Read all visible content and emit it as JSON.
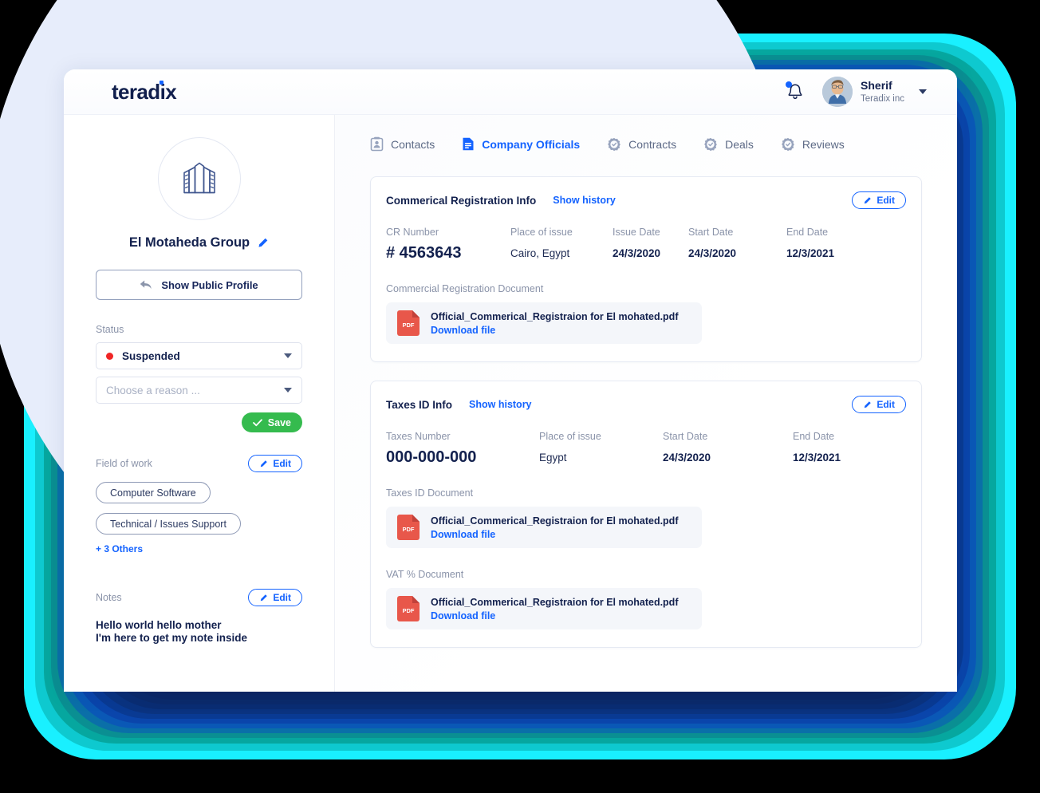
{
  "header": {
    "brand": "teradix",
    "bell_icon": "bell-icon",
    "user": {
      "name": "Sherif",
      "org": "Teradix inc"
    }
  },
  "sidebar": {
    "company_icon": "building-icon",
    "company_name": "El Motaheda Group",
    "edit_name_icon": "pencil-icon",
    "public_profile_button": "Show Public Profile",
    "public_profile_icon": "back-arrow-icon",
    "status_label": "Status",
    "status_value": "Suspended",
    "status_color": "#f02525",
    "reason_placeholder": "Choose a reason ...",
    "save_button": "Save",
    "save_color": "#35bb4e",
    "field_of_work_label": "Field of work",
    "edit_label": "Edit",
    "tags": [
      "Computer Software",
      "Technical / Issues Support"
    ],
    "more_others": "+ 3 Others",
    "notes_label": "Notes",
    "notes_line1": "Hello world hello mother",
    "notes_line2": "I'm here to get my note inside"
  },
  "tabs": [
    {
      "label": "Contacts",
      "icon": "contact-card-icon",
      "active": false
    },
    {
      "label": "Company Officials",
      "icon": "document-icon",
      "active": true
    },
    {
      "label": "Contracts",
      "icon": "badge-check-icon",
      "active": false
    },
    {
      "label": "Deals",
      "icon": "badge-check-icon",
      "active": false
    },
    {
      "label": "Reviews",
      "icon": "badge-check-icon",
      "active": false
    }
  ],
  "cards": [
    {
      "title": "Commerical Registration Info",
      "show_history": "Show history",
      "edit_label": "Edit",
      "fields": [
        {
          "key": "CR Number",
          "value": "# 4563643"
        },
        {
          "key": "Place of issue",
          "value": "Cairo,  Egypt"
        },
        {
          "key": "Issue Date",
          "value": "24/3/2020"
        },
        {
          "key": "Start Date",
          "value": "24/3/2020"
        },
        {
          "key": "End Date",
          "value": "12/3/2021"
        }
      ],
      "documents": [
        {
          "label": "Commercial Registration Document",
          "file_icon": "pdf-icon",
          "file_name": "Official_Commerical_Registraion for El mohated.pdf",
          "download": "Download file"
        }
      ]
    },
    {
      "title": "Taxes ID Info",
      "show_history": "Show history",
      "edit_label": "Edit",
      "fields": [
        {
          "key": "Taxes Number",
          "value": "000-000-000"
        },
        {
          "key": "Place of issue",
          "value": "Egypt"
        },
        {
          "key": "Start Date",
          "value": "24/3/2020"
        },
        {
          "key": "End Date",
          "value": "12/3/2021"
        }
      ],
      "documents": [
        {
          "label": "Taxes ID Document",
          "file_icon": "pdf-icon",
          "file_name": "Official_Commerical_Registraion for El mohated.pdf",
          "download": "Download file"
        },
        {
          "label": "VAT % Document",
          "file_icon": "pdf-icon",
          "file_name": "Official_Commerical_Registraion for El mohated.pdf",
          "download": "Download file"
        }
      ]
    }
  ],
  "theme": {
    "accent": "#1463ff",
    "navy": "#13214e",
    "cyan": "#19f0ff",
    "pdf_red": "#e8574a"
  }
}
